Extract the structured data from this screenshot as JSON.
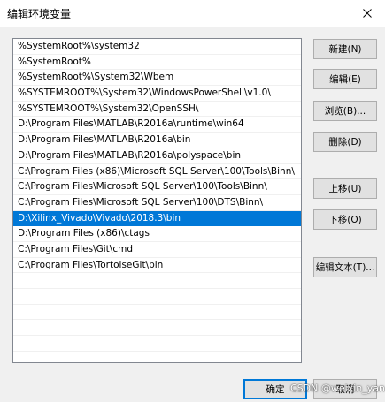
{
  "window": {
    "title": "编辑环境变量",
    "close_glyph": "✕"
  },
  "paths": [
    "%SystemRoot%\\system32",
    "%SystemRoot%",
    "%SystemRoot%\\System32\\Wbem",
    "%SYSTEMROOT%\\System32\\WindowsPowerShell\\v1.0\\",
    "%SYSTEMROOT%\\System32\\OpenSSH\\",
    "D:\\Program Files\\MATLAB\\R2016a\\runtime\\win64",
    "D:\\Program Files\\MATLAB\\R2016a\\bin",
    "D:\\Program Files\\MATLAB\\R2016a\\polyspace\\bin",
    "C:\\Program Files (x86)\\Microsoft SQL Server\\100\\Tools\\Binn\\",
    "C:\\Program Files\\Microsoft SQL Server\\100\\Tools\\Binn\\",
    "C:\\Program Files\\Microsoft SQL Server\\100\\DTS\\Binn\\",
    "D:\\Xilinx_Vivado\\Vivado\\2018.3\\bin",
    "D:\\Program Files (x86)\\ctags",
    "C:\\Program Files\\Git\\cmd",
    "C:\\Program Files\\TortoiseGit\\bin"
  ],
  "selected_index": 11,
  "empty_rows": 6,
  "buttons": {
    "new": "新建(N)",
    "edit": "编辑(E)",
    "browse": "浏览(B)...",
    "delete": "删除(D)",
    "move_up": "上移(U)",
    "move_down": "下移(O)",
    "edit_text": "编辑文本(T)...",
    "ok": "确定",
    "cancel": "取消"
  },
  "watermark": "CSDN @weixin_yan",
  "colors": {
    "selection": "#0078d7",
    "dialog_bg": "#f0f0f0",
    "button_bg": "#e1e1e1"
  }
}
